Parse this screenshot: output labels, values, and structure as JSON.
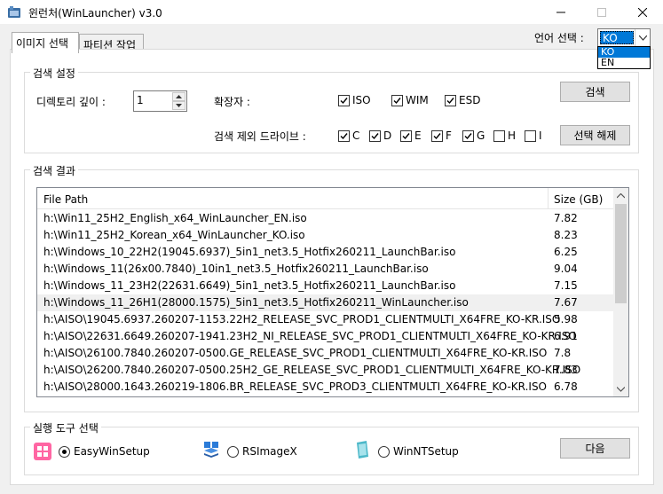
{
  "window": {
    "title": "윈런처(WinLauncher) v3.0"
  },
  "tabs": [
    {
      "label": "이미지 선택"
    },
    {
      "label": "파티션 작업"
    }
  ],
  "language": {
    "label": "언어 선택 :",
    "selected": "KO",
    "options": [
      "KO",
      "EN"
    ]
  },
  "search_settings": {
    "title": "검색 설정",
    "depth_label": "디렉토리 깊이 :",
    "depth_value": "1",
    "ext_label": "확장자 :",
    "extensions": [
      {
        "label": "ISO",
        "checked": true
      },
      {
        "label": "WIM",
        "checked": true
      },
      {
        "label": "ESD",
        "checked": true
      }
    ],
    "exclude_label": "검색 제외 드라이브 :",
    "drives": [
      {
        "label": "C",
        "checked": true
      },
      {
        "label": "D",
        "checked": true
      },
      {
        "label": "E",
        "checked": true
      },
      {
        "label": "F",
        "checked": true
      },
      {
        "label": "G",
        "checked": true
      },
      {
        "label": "H",
        "checked": false
      },
      {
        "label": "I",
        "checked": false
      }
    ],
    "search_button": "검색",
    "deselect_button": "선택 해제"
  },
  "results": {
    "title": "검색 결과",
    "columns": [
      "File Path",
      "Size (GB)"
    ],
    "rows": [
      {
        "path": "h:\\Win11_25H2_English_x64_WinLauncher_EN.iso",
        "size": "7.82"
      },
      {
        "path": "h:\\Win11_25H2_Korean_x64_WinLauncher_KO.iso",
        "size": "8.23"
      },
      {
        "path": "h:\\Windows_10_22H2(19045.6937)_5in1_net3.5_Hotfix260211_LaunchBar.iso",
        "size": "6.25"
      },
      {
        "path": "h:\\Windows_11(26x00.7840)_10in1_net3.5_Hotfix260211_LaunchBar.iso",
        "size": "9.04"
      },
      {
        "path": "h:\\Windows_11_23H2(22631.6649)_5in1_net3.5_Hotfix260211_LaunchBar.iso",
        "size": "7.15"
      },
      {
        "path": "h:\\Windows_11_26H1(28000.1575)_5in1_net3.5_Hotfix260211_WinLauncher.iso",
        "size": "7.67"
      },
      {
        "path": "h:\\AISO\\19045.6937.260207-1153.22H2_RELEASE_SVC_PROD1_CLIENTMULTI_X64FRE_KO-KR.ISO",
        "size": "5.98"
      },
      {
        "path": "h:\\AISO\\22631.6649.260207-1941.23H2_NI_RELEASE_SVC_PROD1_CLIENTMULTI_X64FRE_KO-KR.ISO",
        "size": "6.91"
      },
      {
        "path": "h:\\AISO\\26100.7840.260207-0500.GE_RELEASE_SVC_PROD1_CLIENTMULTI_X64FRE_KO-KR.ISO",
        "size": "7.8"
      },
      {
        "path": "h:\\AISO\\26200.7840.260207-0500.25H2_GE_RELEASE_SVC_PROD1_CLIENTMULTI_X64FRE_KO-KR.ISO",
        "size": "7.83"
      },
      {
        "path": "h:\\AISO\\28000.1643.260219-1806.BR_RELEASE_SVC_PROD3_CLIENTMULTI_X64FRE_KO-KR.ISO",
        "size": "6.78"
      }
    ],
    "selected_row": 5
  },
  "tools": {
    "title": "실행 도구 선택",
    "options": [
      {
        "label": "EasyWinSetup",
        "checked": true,
        "icon": "easywinsetup-icon"
      },
      {
        "label": "RSImageX",
        "checked": false,
        "icon": "rsimagex-icon"
      },
      {
        "label": "WinNTSetup",
        "checked": false,
        "icon": "winntsetup-icon"
      }
    ],
    "next_button": "다음"
  },
  "colors": {
    "accent": "#0078d7",
    "easywinsetup": "#ff66a3",
    "rsimagex": "#2b7bd8",
    "winntsetup": "#4cb8c9"
  }
}
